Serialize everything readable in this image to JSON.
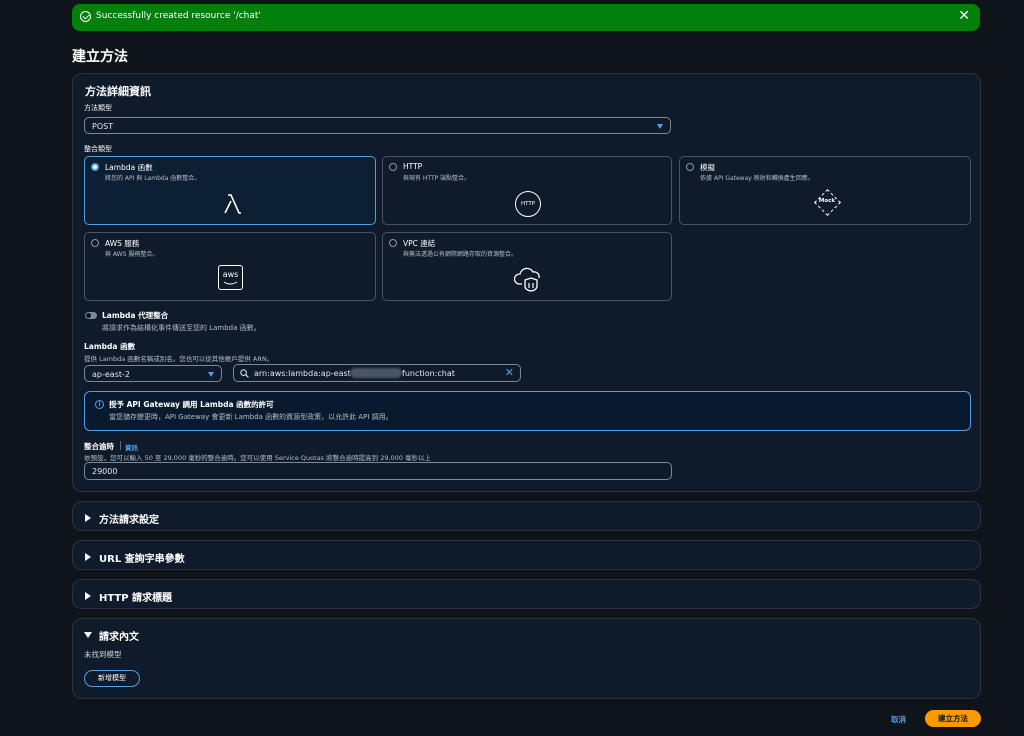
{
  "flash": {
    "message": "Successfully created resource '/chat'"
  },
  "page": {
    "title": "建立方法"
  },
  "details": {
    "title": "方法詳細資訊",
    "method_type": {
      "label": "方法類型",
      "value": "POST"
    },
    "integration_type": {
      "label": "整合類型",
      "options": [
        {
          "title": "Lambda 函數",
          "desc": "將您的 API 與 Lambda 函數整合。",
          "icon": "lambda-icon",
          "selected": true
        },
        {
          "title": "HTTP",
          "desc": "與現有 HTTP 端點整合。",
          "icon": "http-icon",
          "icon_text": "HTTP",
          "selected": false
        },
        {
          "title": "模擬",
          "desc": "依據 API Gateway 映射和轉換產生回應。",
          "icon": "mock-icon",
          "icon_text": "Mock",
          "selected": false
        },
        {
          "title": "AWS 服務",
          "desc": "與 AWS 服務整合。",
          "icon": "aws-icon",
          "icon_text": "aws",
          "selected": false
        },
        {
          "title": "VPC 連結",
          "desc": "與無法透過公有網際網路存取的資源整合。",
          "icon": "vpc-cloud-icon",
          "selected": false
        }
      ]
    },
    "proxy": {
      "label": "Lambda 代理整合",
      "desc": "將請求作為結構化事件傳送至您的 Lambda 函數。",
      "enabled": false
    },
    "lambda_function": {
      "label": "Lambda 函數",
      "desc": "提供 Lambda 函數名稱或別名。您也可以從其他帳戶提供 ARN。",
      "region": "ap-east-2",
      "arn_prefix": "arn:aws:lambda:ap-east-2:",
      "arn_suffix": "function:chat"
    },
    "permission": {
      "title": "授予 API Gateway 調用 Lambda 函數的許可",
      "desc": "當您儲存變更時，API Gateway 會更新 Lambda 函數的資源型政策，以允許此 API 調用。"
    },
    "timeout": {
      "label": "整合逾時",
      "info": "資訊",
      "desc": "依預設，您可以輸入 50 至 29,000 毫秒的整合逾時。您可以使用 Service Quotas 將整合逾時提高到 29,000 毫秒以上",
      "value": "29000"
    }
  },
  "sections": {
    "method_request": "方法請求設定",
    "url_query": "URL 查詢字串參數",
    "http_headers": "HTTP 請求標題",
    "request_body": {
      "title": "請求內文",
      "empty": "未找到模型",
      "add_model": "新增模型"
    }
  },
  "footer": {
    "cancel": "取消",
    "create": "建立方法"
  },
  "colors": {
    "accent": "#539fe5",
    "primary": "#ff9900",
    "success": "#037f0c"
  }
}
